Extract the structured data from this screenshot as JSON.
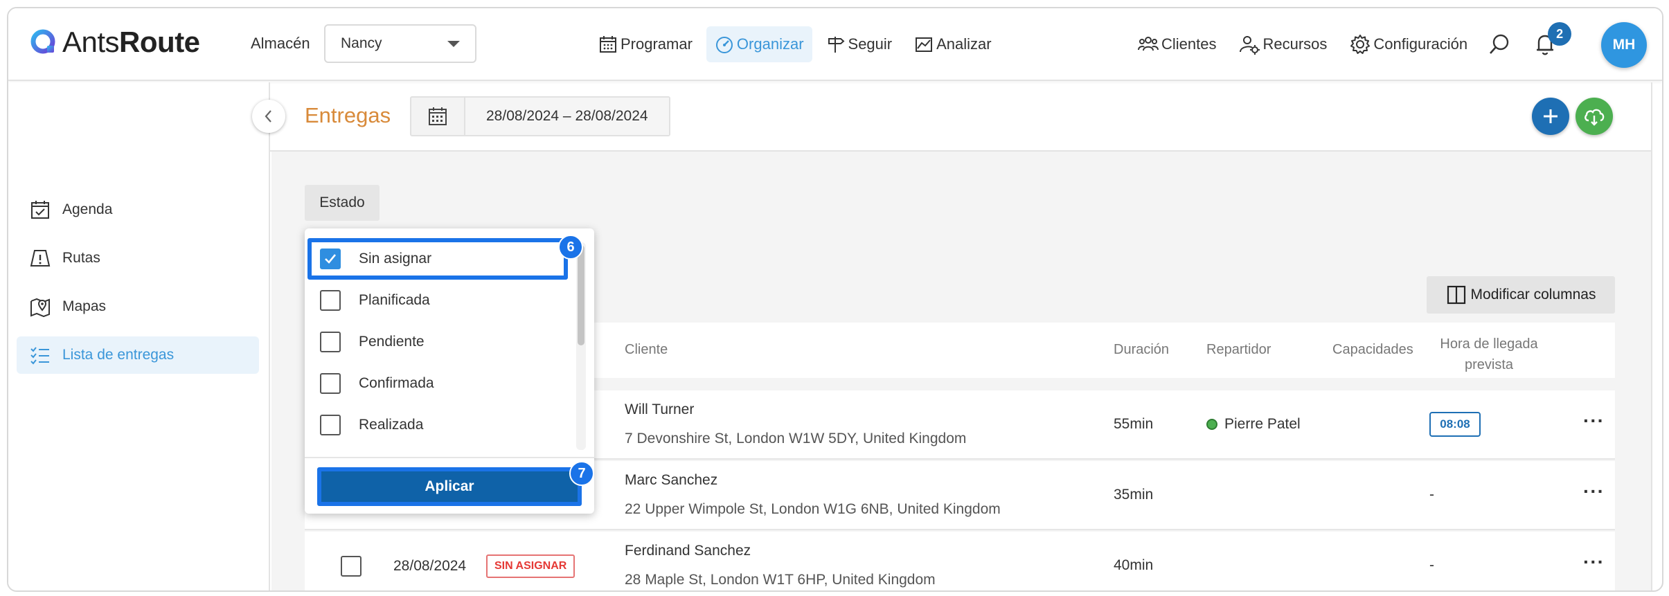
{
  "app": {
    "brand_light": "Ants",
    "brand_bold": "Route"
  },
  "header": {
    "warehouse_label": "Almacén",
    "warehouse_value": "Nancy",
    "nav": [
      {
        "label": "Programar",
        "icon": "calendar-icon"
      },
      {
        "label": "Organizar",
        "icon": "speedometer-icon",
        "active": true
      },
      {
        "label": "Seguir",
        "icon": "signpost-icon"
      },
      {
        "label": "Analizar",
        "icon": "chart-icon"
      }
    ],
    "right_nav": [
      {
        "label": "Clientes",
        "icon": "users-icon"
      },
      {
        "label": "Recursos",
        "icon": "user-gear-icon"
      },
      {
        "label": "Configuración",
        "icon": "gear-icon"
      }
    ],
    "notifications_count": "2",
    "avatar_initials": "MH"
  },
  "sidebar": {
    "items": [
      {
        "label": "Agenda",
        "icon": "calendar-check-icon"
      },
      {
        "label": "Rutas",
        "icon": "route-warning-icon"
      },
      {
        "label": "Mapas",
        "icon": "map-pin-icon"
      },
      {
        "label": "Lista de entregas",
        "icon": "checklist-icon",
        "active": true
      }
    ]
  },
  "main": {
    "title": "Entregas",
    "date_range": "28/08/2024 – 28/08/2024",
    "filter_chip": "Estado",
    "modify_columns": "Modificar columnas",
    "columns": {
      "cliente": "Cliente",
      "duracion": "Duración",
      "repartidor": "Repartidor",
      "capacidades": "Capacidades",
      "hora_line1": "Hora de llegada",
      "hora_line2": "prevista"
    },
    "rows": [
      {
        "name": "Will Turner",
        "address": "7 Devonshire St, London W1W 5DY, United Kingdom",
        "duration": "55min",
        "driver": "Pierre Patel",
        "eta": "08:08"
      },
      {
        "name": "Marc Sanchez",
        "address": "22 Upper Wimpole St, London W1G 6NB, United Kingdom",
        "duration": "35min",
        "driver": "",
        "eta": "-"
      },
      {
        "date": "28/08/2024",
        "status": "SIN ASIGNAR",
        "name": "Ferdinand Sanchez",
        "address": "28 Maple St, London W1T 6HP, United Kingdom",
        "duration": "40min",
        "driver": "",
        "eta": "-"
      }
    ],
    "more_label": "···"
  },
  "status_dropdown": {
    "options": [
      {
        "label": "Sin asignar",
        "checked": true
      },
      {
        "label": "Planificada",
        "checked": false
      },
      {
        "label": "Pendiente",
        "checked": false
      },
      {
        "label": "Confirmada",
        "checked": false
      },
      {
        "label": "Realizada",
        "checked": false
      }
    ],
    "apply_label": "Aplicar",
    "step_option": "6",
    "step_apply": "7"
  },
  "colors": {
    "accent": "#3a96d9",
    "title_orange": "#d88a3a",
    "primary_dark": "#0f62a8",
    "highlight": "#1a73e8",
    "status_red": "#e53935",
    "success": "#4caf50"
  }
}
